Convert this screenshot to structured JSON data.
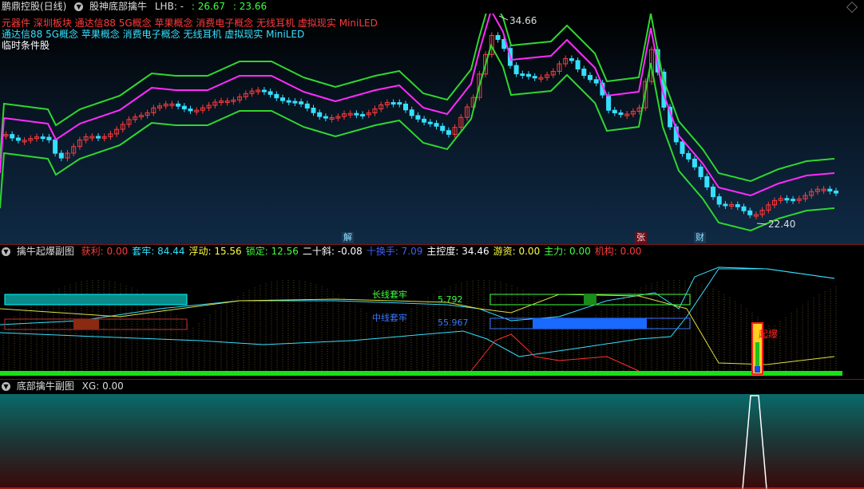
{
  "header": {
    "app_title": "鹏鼎控股(日线)",
    "indicator_name": "股神底部擒牛",
    "lhb_label": "LHB: -",
    "value1": ": 26.67",
    "value2": ": 23.66",
    "restore_icon": "diamond-icon"
  },
  "concepts": {
    "line1": "元器件 深圳板块 通达信88 5G概念 苹果概念 消费电子概念 无线耳机 虚拟现实 MiniLED",
    "line2": "通达信88 5G概念 苹果概念 消费电子概念 无线耳机 虚拟现实 MiniLED",
    "line3": "临时条件股"
  },
  "main_chart": {
    "high_label": "34.66",
    "low_label": "22.40",
    "badges": [
      {
        "text": "解",
        "color": "#2aa0c8"
      },
      {
        "text": "张",
        "color": "#c8203a"
      },
      {
        "text": "财",
        "color": "#2aa0c8"
      }
    ],
    "colors": {
      "up": "#ff3b3b",
      "down": "#35e0ff",
      "upper_band": "#ff2bff",
      "lower_band": "#2fd62f"
    }
  },
  "sub1": {
    "title": "擒牛起爆副图",
    "stats": [
      {
        "label": "获利: ",
        "value": "0.00",
        "color": "#ff3b3b"
      },
      {
        "label": "套牢: ",
        "value": "84.44",
        "color": "#35e0ff"
      },
      {
        "label": "浮动: ",
        "value": "15.56",
        "color": "#ffff40"
      },
      {
        "label": "锁定: ",
        "value": "12.56",
        "color": "#40ff40"
      },
      {
        "label": "二十斜: ",
        "value": "-0.08",
        "color": "#ffffff"
      },
      {
        "label": "十换手: ",
        "value": "7.09",
        "color": "#4060ff"
      },
      {
        "label": "主控度: ",
        "value": "34.46",
        "color": "#ffffff"
      },
      {
        "label": "游资: ",
        "value": "0.00",
        "color": "#ffff40"
      },
      {
        "label": "主力: ",
        "value": "0.00",
        "color": "#40ff40"
      },
      {
        "label": "机构: ",
        "value": "0.00",
        "color": "#ff3b3b"
      }
    ],
    "long_label": "长线套牢",
    "long_value": "5.792",
    "mid_label": "中线套牢",
    "mid_value": "55.967",
    "explode_label": "起爆"
  },
  "sub2": {
    "title": "底部擒牛副图",
    "xg_label": "XG: ",
    "xg_value": "0.00"
  }
}
